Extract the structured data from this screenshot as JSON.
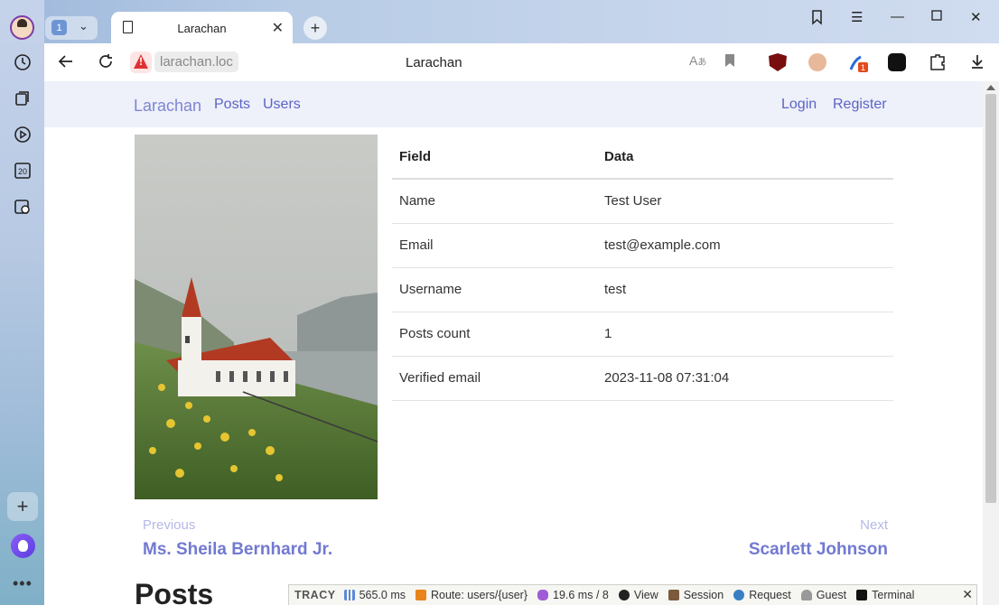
{
  "browser": {
    "tab_group_count": "1",
    "tab_title": "Larachan",
    "address_domain": "larachan.loc",
    "page_title": "Larachan",
    "extension_badge": "1",
    "sidebar_calendar_day": "20"
  },
  "navbar": {
    "brand": "Larachan",
    "links": [
      "Posts",
      "Users"
    ],
    "auth_links": [
      "Login",
      "Register"
    ]
  },
  "user_table": {
    "headers": [
      "Field",
      "Data"
    ],
    "rows": [
      [
        "Name",
        "Test User"
      ],
      [
        "Email",
        "test@example.com"
      ],
      [
        "Username",
        "test"
      ],
      [
        "Posts count",
        "1"
      ],
      [
        "Verified email",
        "2023-11-08 07:31:04"
      ]
    ]
  },
  "pager": {
    "previous_label": "Previous",
    "previous_name": "Ms. Sheila Bernhard Jr.",
    "next_label": "Next",
    "next_name": "Scarlett Johnson"
  },
  "section_heading": "Posts",
  "tracy": {
    "logo": "TRACY",
    "time": "565.0 ms",
    "route": "Route: users/{user}",
    "db_time": "19.6 ms",
    "db_count": "/ 8",
    "view": "View",
    "session": "Session",
    "request": "Request",
    "guest": "Guest",
    "terminal": "Terminal"
  },
  "colors": {
    "brand": "#7e86cf",
    "link": "#5b64c4",
    "navbar_bg": "#eef0fa"
  }
}
